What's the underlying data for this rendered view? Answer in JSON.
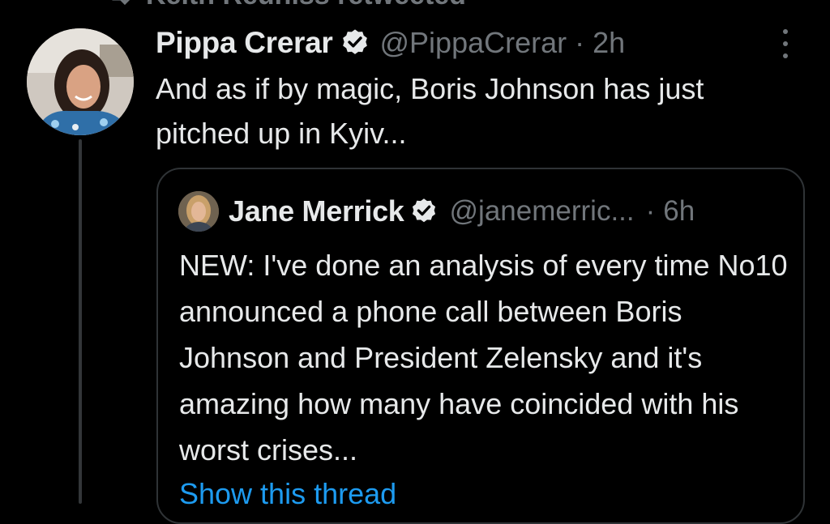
{
  "context": {
    "label": "Keith Reuniss retweeted",
    "icon": "retweet-icon"
  },
  "tweet": {
    "display_name": "Pippa Crerar",
    "handle": "@PippaCrerar",
    "separator": "·",
    "time": "2h",
    "text": "And as if by magic, Boris Johnson has just pitched up in Kyiv...",
    "verified_icon": "verified-badge-icon",
    "more_icon": "more-options-icon"
  },
  "quote": {
    "display_name": "Jane Merrick",
    "handle": "@janemerric...",
    "separator": "·",
    "time": "6h",
    "text": "NEW: I've done an analysis of every time No10 announced a phone call between Boris Johnson and President Zelensky and it's amazing how many have coincided with his worst crises...",
    "show_thread": "Show this thread"
  },
  "colors": {
    "background": "#000000",
    "primary_text": "#e7e9ea",
    "secondary_text": "#71767b",
    "border": "#2f3336",
    "link": "#1d9bf0"
  }
}
